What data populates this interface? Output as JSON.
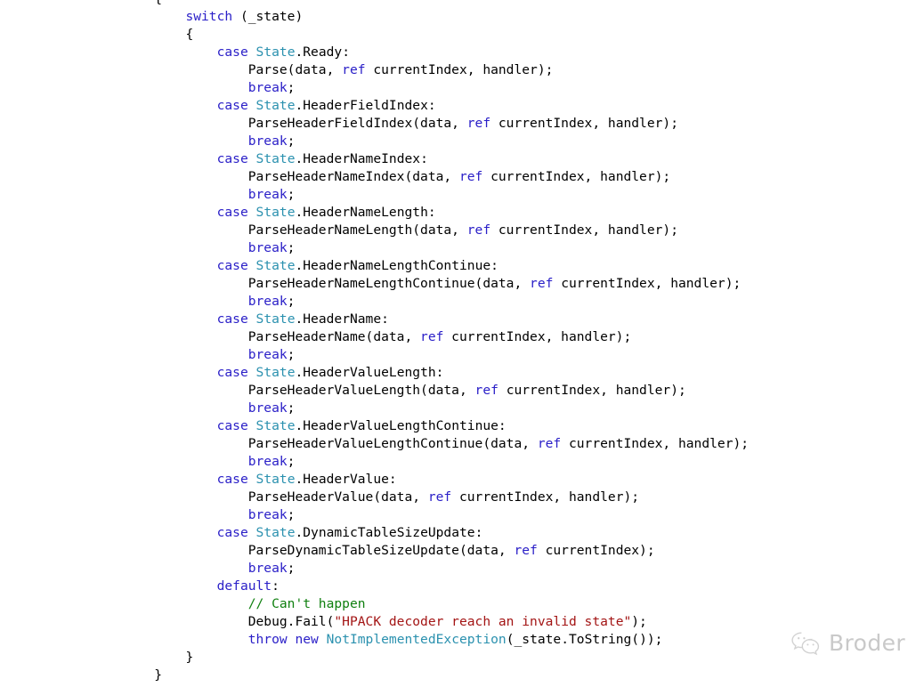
{
  "editor": {
    "language": "csharp",
    "theme": "visual-studio-light",
    "background": "#ffffff",
    "colors": {
      "keyword": "#2b20c8",
      "type": "#2b91af",
      "comment": "#108010",
      "string": "#a31515",
      "plain": "#000000"
    },
    "lines": [
      {
        "indent": 2,
        "tokens": [
          {
            "t": "{",
            "c": "pln"
          }
        ]
      },
      {
        "indent": 3,
        "tokens": [
          {
            "t": "switch",
            "c": "kw"
          },
          {
            "t": " (_state)",
            "c": "pln"
          }
        ]
      },
      {
        "indent": 3,
        "tokens": [
          {
            "t": "{",
            "c": "pln"
          }
        ]
      },
      {
        "indent": 4,
        "tokens": [
          {
            "t": "case",
            "c": "kw"
          },
          {
            "t": " ",
            "c": "pln"
          },
          {
            "t": "State",
            "c": "typ"
          },
          {
            "t": ".Ready:",
            "c": "pln"
          }
        ]
      },
      {
        "indent": 5,
        "tokens": [
          {
            "t": "Parse(data, ",
            "c": "pln"
          },
          {
            "t": "ref",
            "c": "kw"
          },
          {
            "t": " currentIndex, handler);",
            "c": "pln"
          }
        ]
      },
      {
        "indent": 5,
        "tokens": [
          {
            "t": "break",
            "c": "kw"
          },
          {
            "t": ";",
            "c": "pln"
          }
        ]
      },
      {
        "indent": 4,
        "tokens": [
          {
            "t": "case",
            "c": "kw"
          },
          {
            "t": " ",
            "c": "pln"
          },
          {
            "t": "State",
            "c": "typ"
          },
          {
            "t": ".HeaderFieldIndex:",
            "c": "pln"
          }
        ]
      },
      {
        "indent": 5,
        "tokens": [
          {
            "t": "ParseHeaderFieldIndex(data, ",
            "c": "pln"
          },
          {
            "t": "ref",
            "c": "kw"
          },
          {
            "t": " currentIndex, handler);",
            "c": "pln"
          }
        ]
      },
      {
        "indent": 5,
        "tokens": [
          {
            "t": "break",
            "c": "kw"
          },
          {
            "t": ";",
            "c": "pln"
          }
        ]
      },
      {
        "indent": 4,
        "tokens": [
          {
            "t": "case",
            "c": "kw"
          },
          {
            "t": " ",
            "c": "pln"
          },
          {
            "t": "State",
            "c": "typ"
          },
          {
            "t": ".HeaderNameIndex:",
            "c": "pln"
          }
        ]
      },
      {
        "indent": 5,
        "tokens": [
          {
            "t": "ParseHeaderNameIndex(data, ",
            "c": "pln"
          },
          {
            "t": "ref",
            "c": "kw"
          },
          {
            "t": " currentIndex, handler);",
            "c": "pln"
          }
        ]
      },
      {
        "indent": 5,
        "tokens": [
          {
            "t": "break",
            "c": "kw"
          },
          {
            "t": ";",
            "c": "pln"
          }
        ]
      },
      {
        "indent": 4,
        "tokens": [
          {
            "t": "case",
            "c": "kw"
          },
          {
            "t": " ",
            "c": "pln"
          },
          {
            "t": "State",
            "c": "typ"
          },
          {
            "t": ".HeaderNameLength:",
            "c": "pln"
          }
        ]
      },
      {
        "indent": 5,
        "tokens": [
          {
            "t": "ParseHeaderNameLength(data, ",
            "c": "pln"
          },
          {
            "t": "ref",
            "c": "kw"
          },
          {
            "t": " currentIndex, handler);",
            "c": "pln"
          }
        ]
      },
      {
        "indent": 5,
        "tokens": [
          {
            "t": "break",
            "c": "kw"
          },
          {
            "t": ";",
            "c": "pln"
          }
        ]
      },
      {
        "indent": 4,
        "tokens": [
          {
            "t": "case",
            "c": "kw"
          },
          {
            "t": " ",
            "c": "pln"
          },
          {
            "t": "State",
            "c": "typ"
          },
          {
            "t": ".HeaderNameLengthContinue:",
            "c": "pln"
          }
        ]
      },
      {
        "indent": 5,
        "tokens": [
          {
            "t": "ParseHeaderNameLengthContinue(data, ",
            "c": "pln"
          },
          {
            "t": "ref",
            "c": "kw"
          },
          {
            "t": " currentIndex, handler);",
            "c": "pln"
          }
        ]
      },
      {
        "indent": 5,
        "tokens": [
          {
            "t": "break",
            "c": "kw"
          },
          {
            "t": ";",
            "c": "pln"
          }
        ]
      },
      {
        "indent": 4,
        "tokens": [
          {
            "t": "case",
            "c": "kw"
          },
          {
            "t": " ",
            "c": "pln"
          },
          {
            "t": "State",
            "c": "typ"
          },
          {
            "t": ".HeaderName:",
            "c": "pln"
          }
        ]
      },
      {
        "indent": 5,
        "tokens": [
          {
            "t": "ParseHeaderName(data, ",
            "c": "pln"
          },
          {
            "t": "ref",
            "c": "kw"
          },
          {
            "t": " currentIndex, handler);",
            "c": "pln"
          }
        ]
      },
      {
        "indent": 5,
        "tokens": [
          {
            "t": "break",
            "c": "kw"
          },
          {
            "t": ";",
            "c": "pln"
          }
        ]
      },
      {
        "indent": 4,
        "tokens": [
          {
            "t": "case",
            "c": "kw"
          },
          {
            "t": " ",
            "c": "pln"
          },
          {
            "t": "State",
            "c": "typ"
          },
          {
            "t": ".HeaderValueLength:",
            "c": "pln"
          }
        ]
      },
      {
        "indent": 5,
        "tokens": [
          {
            "t": "ParseHeaderValueLength(data, ",
            "c": "pln"
          },
          {
            "t": "ref",
            "c": "kw"
          },
          {
            "t": " currentIndex, handler);",
            "c": "pln"
          }
        ]
      },
      {
        "indent": 5,
        "tokens": [
          {
            "t": "break",
            "c": "kw"
          },
          {
            "t": ";",
            "c": "pln"
          }
        ]
      },
      {
        "indent": 4,
        "tokens": [
          {
            "t": "case",
            "c": "kw"
          },
          {
            "t": " ",
            "c": "pln"
          },
          {
            "t": "State",
            "c": "typ"
          },
          {
            "t": ".HeaderValueLengthContinue:",
            "c": "pln"
          }
        ]
      },
      {
        "indent": 5,
        "tokens": [
          {
            "t": "ParseHeaderValueLengthContinue(data, ",
            "c": "pln"
          },
          {
            "t": "ref",
            "c": "kw"
          },
          {
            "t": " currentIndex, handler);",
            "c": "pln"
          }
        ]
      },
      {
        "indent": 5,
        "tokens": [
          {
            "t": "break",
            "c": "kw"
          },
          {
            "t": ";",
            "c": "pln"
          }
        ]
      },
      {
        "indent": 4,
        "tokens": [
          {
            "t": "case",
            "c": "kw"
          },
          {
            "t": " ",
            "c": "pln"
          },
          {
            "t": "State",
            "c": "typ"
          },
          {
            "t": ".HeaderValue:",
            "c": "pln"
          }
        ]
      },
      {
        "indent": 5,
        "tokens": [
          {
            "t": "ParseHeaderValue(data, ",
            "c": "pln"
          },
          {
            "t": "ref",
            "c": "kw"
          },
          {
            "t": " currentIndex, handler);",
            "c": "pln"
          }
        ]
      },
      {
        "indent": 5,
        "tokens": [
          {
            "t": "break",
            "c": "kw"
          },
          {
            "t": ";",
            "c": "pln"
          }
        ]
      },
      {
        "indent": 4,
        "tokens": [
          {
            "t": "case",
            "c": "kw"
          },
          {
            "t": " ",
            "c": "pln"
          },
          {
            "t": "State",
            "c": "typ"
          },
          {
            "t": ".DynamicTableSizeUpdate:",
            "c": "pln"
          }
        ]
      },
      {
        "indent": 5,
        "tokens": [
          {
            "t": "ParseDynamicTableSizeUpdate(data, ",
            "c": "pln"
          },
          {
            "t": "ref",
            "c": "kw"
          },
          {
            "t": " currentIndex);",
            "c": "pln"
          }
        ]
      },
      {
        "indent": 5,
        "tokens": [
          {
            "t": "break",
            "c": "kw"
          },
          {
            "t": ";",
            "c": "pln"
          }
        ]
      },
      {
        "indent": 4,
        "tokens": [
          {
            "t": "default",
            "c": "kw"
          },
          {
            "t": ":",
            "c": "pln"
          }
        ]
      },
      {
        "indent": 5,
        "tokens": [
          {
            "t": "// Can't happen",
            "c": "cmt"
          }
        ]
      },
      {
        "indent": 5,
        "tokens": [
          {
            "t": "Debug.Fail(",
            "c": "pln"
          },
          {
            "t": "\"HPACK decoder reach an invalid state\"",
            "c": "str"
          },
          {
            "t": ");",
            "c": "pln"
          }
        ]
      },
      {
        "indent": 5,
        "tokens": [
          {
            "t": "throw",
            "c": "kw"
          },
          {
            "t": " ",
            "c": "pln"
          },
          {
            "t": "new",
            "c": "kw"
          },
          {
            "t": " ",
            "c": "pln"
          },
          {
            "t": "NotImplementedException",
            "c": "typ"
          },
          {
            "t": "(_state.ToString());",
            "c": "pln"
          }
        ]
      },
      {
        "indent": 3,
        "tokens": [
          {
            "t": "}",
            "c": "pln"
          }
        ]
      },
      {
        "indent": 2,
        "tokens": [
          {
            "t": "}",
            "c": "pln"
          }
        ]
      }
    ]
  },
  "watermark": {
    "icon": "wechat-icon",
    "label": "Broder",
    "color": "#c9c9c9"
  }
}
